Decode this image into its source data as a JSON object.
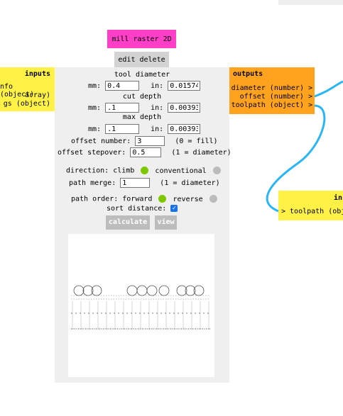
{
  "module": {
    "title": "mill raster 2D",
    "edit_label": "edit",
    "delete_label": "delete"
  },
  "inputs": {
    "title": "inputs",
    "items": [
      "nfo (object)",
      "array)",
      "gs (object)"
    ]
  },
  "outputs": {
    "title": "outputs",
    "items": [
      "diameter (number) >",
      "offset (number) >",
      "toolpath (object) >"
    ]
  },
  "right_inputs": {
    "title": "in",
    "item": "> toolpath (obj"
  },
  "form": {
    "tool_diameter_label": "tool diameter",
    "tool_diameter_mm": "0.4",
    "tool_diameter_in": "0.01574",
    "cut_depth_label": "cut depth",
    "cut_depth_mm": ".1",
    "cut_depth_in": "0.00393",
    "max_depth_label": "max depth",
    "max_depth_mm": ".1",
    "max_depth_in": "0.00393",
    "mm_label": "mm:",
    "in_label": "in:",
    "offset_number_label": "offset number:",
    "offset_number_value": "3",
    "offset_number_note": "(0 = fill)",
    "offset_stepover_label": "offset stepover:",
    "offset_stepover_value": "0.5",
    "offset_stepover_note": "(1 = diameter)",
    "direction_label": "direction:",
    "direction_climb": "climb",
    "direction_conventional": "conventional",
    "path_merge_label": "path merge:",
    "path_merge_value": "1",
    "path_merge_note": "(1 = diameter)",
    "path_order_label": "path order:",
    "path_order_forward": "forward",
    "path_order_reverse": "reverse",
    "sort_distance_label": "sort distance:",
    "sort_distance_checked": true,
    "calculate_label": "calculate",
    "view_label": "view"
  },
  "colors": {
    "module_title_bg": "#ff3fc8",
    "inputs_bg": "#fff145",
    "outputs_bg": "#ffa31f",
    "wire": "#29b6f6",
    "radio_on": "#7ec800",
    "radio_off": "#bbbbbb"
  }
}
